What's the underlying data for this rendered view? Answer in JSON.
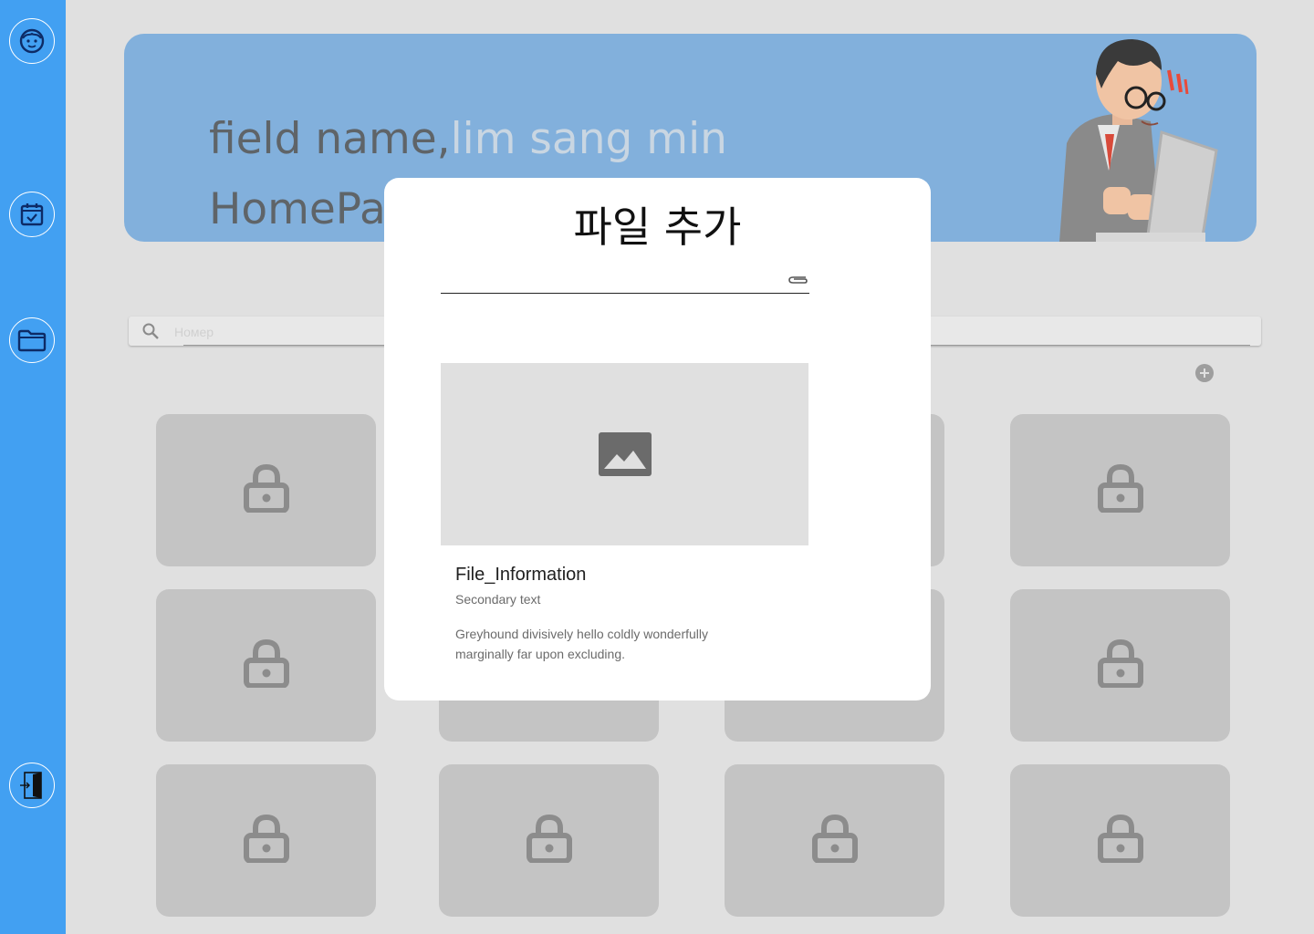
{
  "sidebar": {
    "items": [
      {
        "icon": "profile-face-icon"
      },
      {
        "icon": "calendar-check-icon"
      },
      {
        "icon": "folder-icon"
      },
      {
        "icon": "logout-door-icon"
      }
    ],
    "color": "#42a0f2"
  },
  "banner": {
    "prefix": "field name,",
    "user_name": "lim sang min",
    "subtitle": "HomePage",
    "color": "#82b0dc",
    "illustration": "stressed-office-worker-at-computer"
  },
  "search": {
    "placeholder": "Номер",
    "icon": "search-icon"
  },
  "add_button": {
    "icon": "add-circle-icon"
  },
  "grid": {
    "tile_icon": "lock-icon",
    "rows": 3,
    "columns": 4
  },
  "modal": {
    "title": "파일 추가",
    "file_field": {
      "value": "",
      "icon": "paperclip-icon"
    },
    "card": {
      "media_icon": "image-placeholder-icon",
      "title": "File_Information",
      "secondary": "Secondary text",
      "body": "Greyhound divisively hello coldly wonderfully marginally far upon excluding."
    }
  }
}
